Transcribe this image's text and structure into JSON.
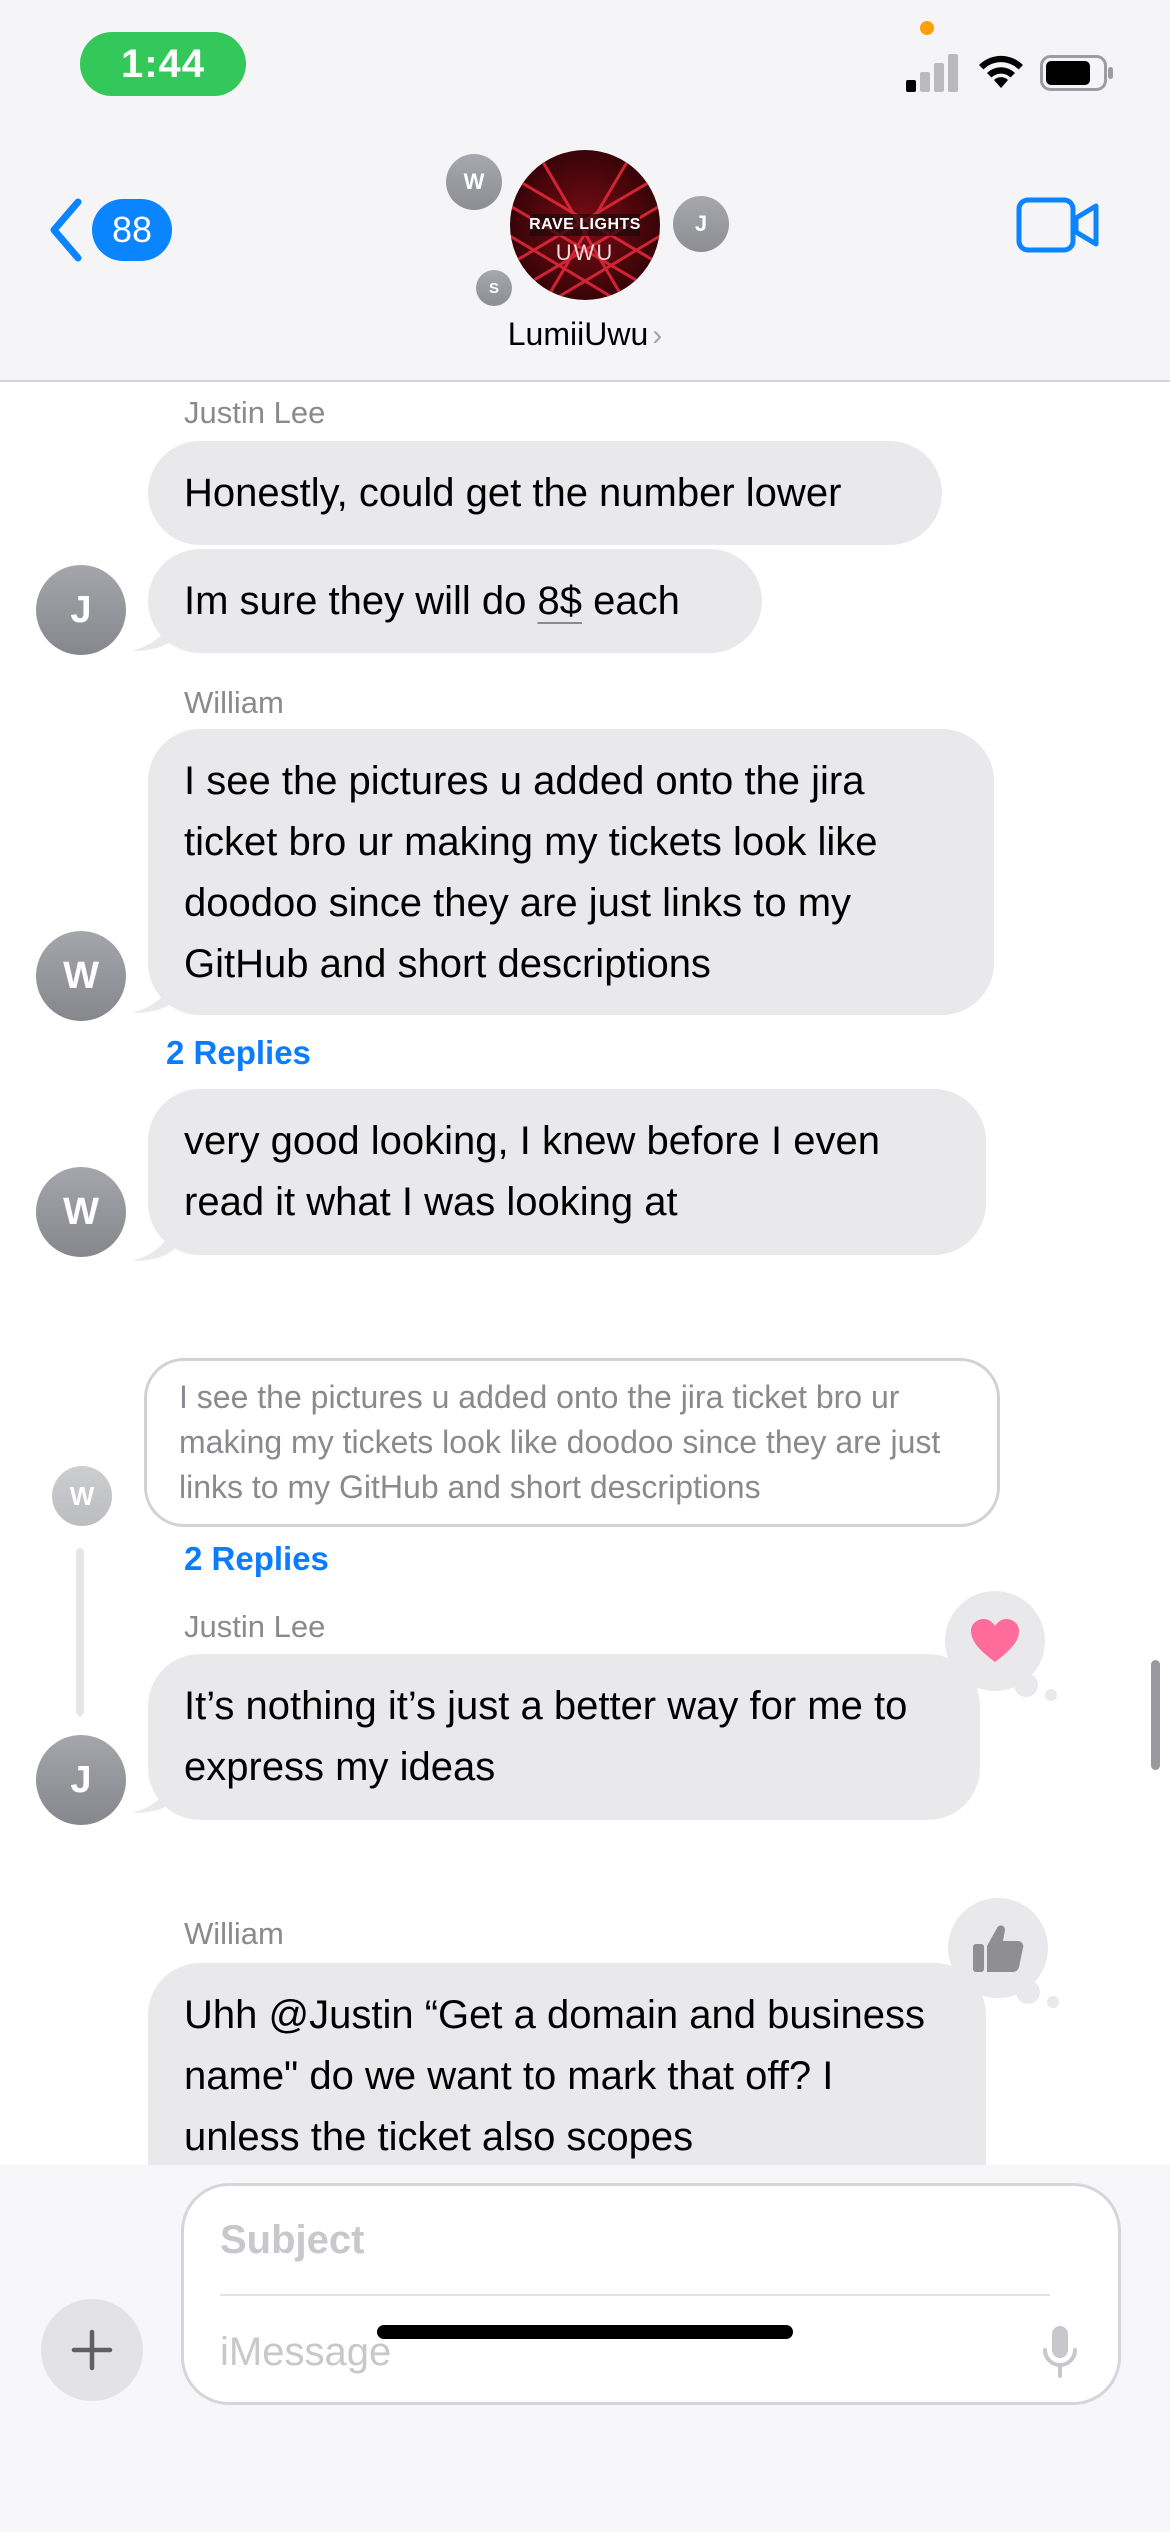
{
  "status_bar": {
    "time": "1:44",
    "icons": [
      "signal-icon",
      "wifi-icon",
      "battery-icon"
    ],
    "mic_indicator_color": "#ff9f0a"
  },
  "header": {
    "back_count": "88",
    "group_name": "LumiiUwu",
    "group_photo_line1": "RAVE LIGHTS",
    "group_photo_line2": "UWU",
    "participants": [
      "W",
      "J",
      "S"
    ],
    "video_icon": "video-camera-icon"
  },
  "messages": [
    {
      "sender": "Justin Lee",
      "text": "Honestly, could get the number lower"
    },
    {
      "text_before": "Im sure they will do ",
      "text_link": "8$",
      "text_after": " each",
      "avatar": "J"
    },
    {
      "sender": "William",
      "text": "I see the pictures u added onto the jira ticket bro ur making my tickets look like doodoo since they are just links to my GitHub and short descriptions",
      "avatar": "W",
      "replies": "2 Replies"
    },
    {
      "text": "very good looking, I knew before I even read it what I was looking at",
      "avatar": "W"
    }
  ],
  "thread": {
    "quoted_text": "I see the pictures u added onto the jira ticket bro ur making my tickets look like doodoo since they are just links to my GitHub and short descriptions",
    "quoted_avatar": "W",
    "replies": "2 Replies",
    "reply": {
      "sender": "Justin Lee",
      "text": "It’s nothing it’s just a better way for me to express my ideas",
      "avatar": "J",
      "tapback": "heart-icon",
      "tapback_color": "#ff6b9a"
    }
  },
  "last_message": {
    "sender": "William",
    "text": "Uhh @Justin “Get a domain and business name\" do we want to mark that off? I unless the ticket also scopes",
    "tapback": "thumbs-up-icon"
  },
  "composer": {
    "subject_placeholder": "Subject",
    "message_placeholder": "iMessage",
    "plus_icon": "plus-icon",
    "mic_icon": "microphone-icon"
  },
  "colors": {
    "accent": "#0a84ff",
    "bubble_gray": "#e9e9eb",
    "time_pill": "#34c759"
  }
}
